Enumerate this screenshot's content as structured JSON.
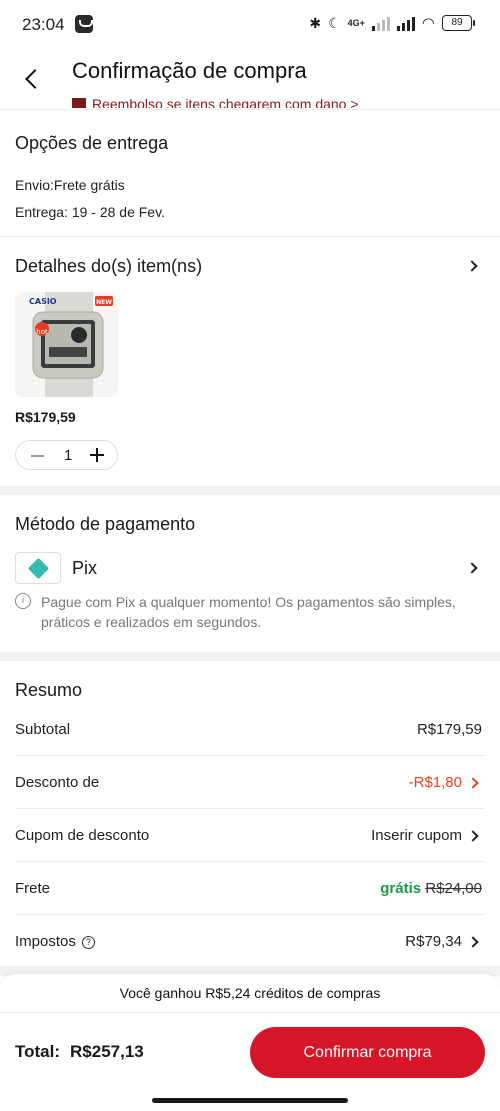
{
  "status_bar": {
    "time": "23:04",
    "network": "4G+",
    "battery": "89"
  },
  "header": {
    "title": "Confirmação de compra",
    "promo": "Reembolso se itens chegarem com dano >"
  },
  "delivery": {
    "title": "Opções de entrega",
    "shipping": "Envio:Frete grátis",
    "eta": "Entrega: 19 - 28 de Fev."
  },
  "items": {
    "title": "Detalhes do(s) item(ns)",
    "product": {
      "brand": "CASIO",
      "badge_hot": "hot",
      "badge_new": "NEW",
      "price": "R$179,59",
      "quantity": "1"
    }
  },
  "payment": {
    "title": "Método de pagamento",
    "method": "Pix",
    "info": "Pague com Pix a qualquer momento! Os pagamentos são simples, práticos e realizados em segundos."
  },
  "summary": {
    "title": "Resumo",
    "subtotal_label": "Subtotal",
    "subtotal_value": "R$179,59",
    "discount_label": "Desconto de",
    "discount_value": "-R$1,80",
    "coupon_label": "Cupom de desconto",
    "coupon_value": "Inserir cupom",
    "shipping_label": "Frete",
    "shipping_free": "grátis",
    "shipping_original": "R$24,00",
    "taxes_label": "Impostos",
    "taxes_value": "R$79,34"
  },
  "footer": {
    "credits": "Você ganhou R$5,24 créditos de compras",
    "total_label": "Total:",
    "total_value": "R$257,13",
    "confirm_label": "Confirmar compra"
  },
  "colors": {
    "accent": "#d71528",
    "discount": "#e8421e",
    "free": "#1a9a4a",
    "pix": "#32bcad"
  }
}
